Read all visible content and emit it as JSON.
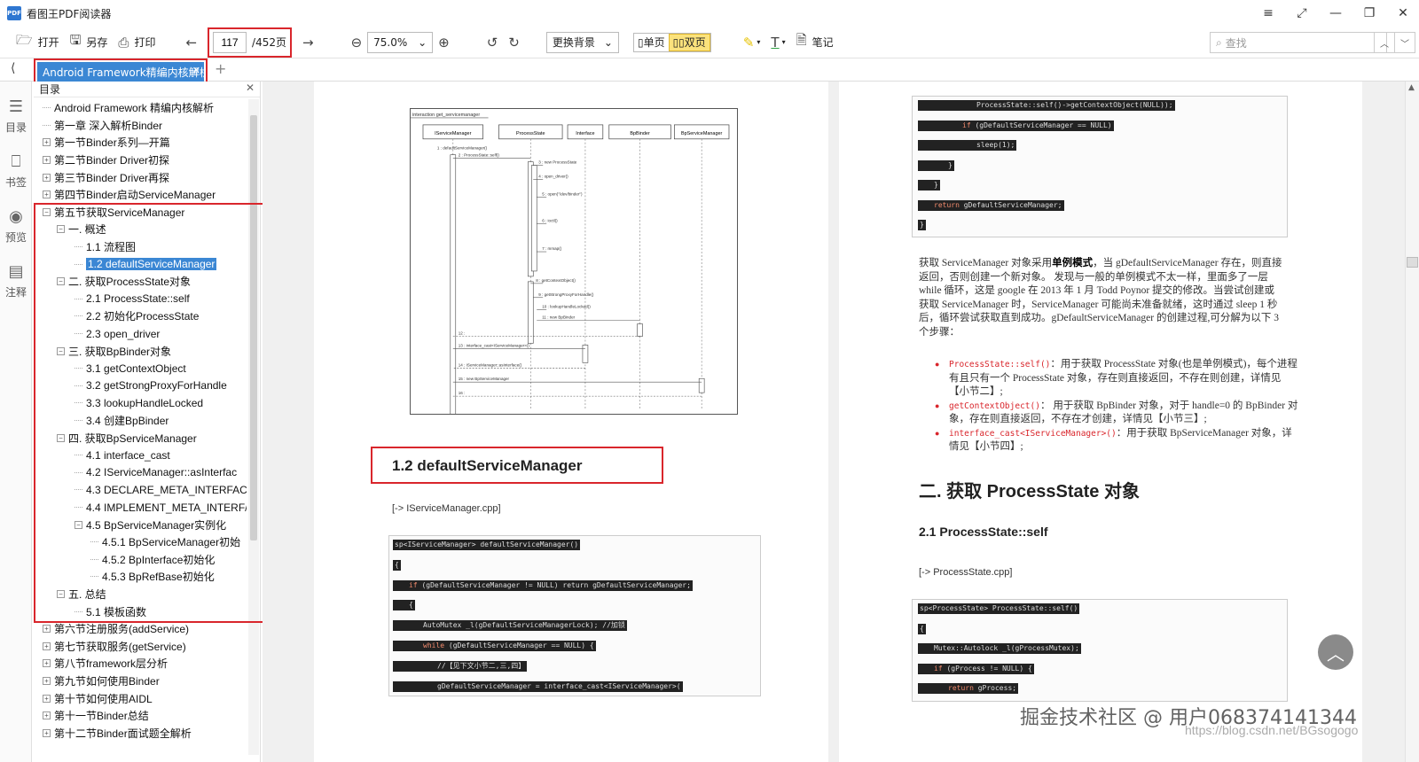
{
  "app": {
    "title": "看图王PDF阅读器",
    "logo_text": "PDF"
  },
  "window_controls": [
    "≡",
    "⤢",
    "—",
    "❐",
    "✕"
  ],
  "toolbar": {
    "open": "打开",
    "save": "另存",
    "print": "打印",
    "page_current": "117",
    "page_total": "/452页",
    "zoom": "75.0%",
    "background": "更换背景",
    "single": "单页",
    "double": "双页",
    "note": "笔记",
    "search_placeholder": "查找"
  },
  "tab": {
    "title": "Android Framework精编内核解析"
  },
  "rail": {
    "toc": "目录",
    "bookmark": "书签",
    "preview": "预览",
    "annot": "注释"
  },
  "outline": {
    "title": "目录",
    "items": [
      {
        "label": "Android Framework 精编内核解析",
        "level": 0,
        "exp": "none"
      },
      {
        "label": "第一章 深入解析Binder",
        "level": 0,
        "exp": "none"
      },
      {
        "label": "第一节Binder系列—开篇",
        "level": 0,
        "exp": "+"
      },
      {
        "label": "第二节Binder Driver初探",
        "level": 0,
        "exp": "+"
      },
      {
        "label": "第三节Binder Driver再探",
        "level": 0,
        "exp": "+"
      },
      {
        "label": "第四节Binder启动ServiceManager",
        "level": 0,
        "exp": "+"
      },
      {
        "label": "第五节获取ServiceManager",
        "level": 0,
        "exp": "-"
      },
      {
        "label": "一. 概述",
        "level": 1,
        "exp": "-"
      },
      {
        "label": "1.1 流程图",
        "level": 2,
        "exp": "none"
      },
      {
        "label": "1.2 defaultServiceManager",
        "level": 2,
        "exp": "none",
        "selected": true
      },
      {
        "label": "二. 获取ProcessState对象",
        "level": 1,
        "exp": "-"
      },
      {
        "label": "2.1 ProcessState::self",
        "level": 2,
        "exp": "none"
      },
      {
        "label": "2.2 初始化ProcessState",
        "level": 2,
        "exp": "none"
      },
      {
        "label": "2.3 open_driver",
        "level": 2,
        "exp": "none"
      },
      {
        "label": "三. 获取BpBinder对象",
        "level": 1,
        "exp": "-"
      },
      {
        "label": "3.1 getContextObject",
        "level": 2,
        "exp": "none"
      },
      {
        "label": "3.2 getStrongProxyForHandle",
        "level": 2,
        "exp": "none"
      },
      {
        "label": "3.3 lookupHandleLocked",
        "level": 2,
        "exp": "none"
      },
      {
        "label": "3.4 创建BpBinder",
        "level": 2,
        "exp": "none"
      },
      {
        "label": "四. 获取BpServiceManager",
        "level": 1,
        "exp": "-"
      },
      {
        "label": "4.1 interface_cast",
        "level": 2,
        "exp": "none"
      },
      {
        "label": "4.2 IServiceManager::asInterfac",
        "level": 2,
        "exp": "none"
      },
      {
        "label": "4.3 DECLARE_META_INTERFACE",
        "level": 2,
        "exp": "none"
      },
      {
        "label": "4.4 IMPLEMENT_META_INTERF/",
        "level": 2,
        "exp": "none"
      },
      {
        "label": "4.5 BpServiceManager实例化",
        "level": 2,
        "exp": "-"
      },
      {
        "label": "4.5.1 BpServiceManager初始",
        "level": 3,
        "exp": "none"
      },
      {
        "label": "4.5.2 BpInterface初始化",
        "level": 3,
        "exp": "none"
      },
      {
        "label": "4.5.3 BpRefBase初始化",
        "level": 3,
        "exp": "none"
      },
      {
        "label": "五. 总结",
        "level": 1,
        "exp": "-"
      },
      {
        "label": "5.1 模板函数",
        "level": 2,
        "exp": "none"
      },
      {
        "label": "第六节注册服务(addService)",
        "level": 0,
        "exp": "+"
      },
      {
        "label": "第七节获取服务(getService)",
        "level": 0,
        "exp": "+"
      },
      {
        "label": "第八节framework层分析",
        "level": 0,
        "exp": "+"
      },
      {
        "label": "第九节如何使用Binder",
        "level": 0,
        "exp": "+"
      },
      {
        "label": "第十节如何使用AIDL",
        "level": 0,
        "exp": "+"
      },
      {
        "label": "第十一节Binder总结",
        "level": 0,
        "exp": "+"
      },
      {
        "label": "第十二节Binder面试题全解析",
        "level": 0,
        "exp": "+"
      }
    ]
  },
  "diagram": {
    "title": "interaction get_servicemanager",
    "lifelines": [
      "IServiceManager",
      "ProcessState",
      "Interface",
      "BpBinder",
      "BpServiceManager"
    ],
    "messages": [
      "1 : defaultServiceManager()",
      "2 : ProcessState::self()",
      "3 : new ProcessState",
      "4 : open_driver()",
      "5 : open(\"/dev/binder\")",
      "6 : ioctl()",
      "7 : mmap()",
      "8 : getContextObject()",
      "9 : getStrongProxyForHandle()",
      "10 : lookupHandleLocked()",
      "11 : new BpBinder",
      "12 :",
      "13 : interface_cast<IServiceManager>()",
      "14 : IServiceManager::asInterface()",
      "15 : new BpServiceManager",
      "16 :"
    ]
  },
  "left_page": {
    "heading": "1.2 defaultServiceManager",
    "src": "[-> IServiceManager.cpp]",
    "code": [
      "sp<IServiceManager> defaultServiceManager()",
      "{",
      "    if (gDefaultServiceManager != NULL) return gDefaultServiceManager;",
      "    {",
      "        AutoMutex _l(gDefaultServiceManagerLock); //加锁",
      "        while (gDefaultServiceManager == NULL) {",
      "            //【见下文小节二,三,四】",
      "            gDefaultServiceManager = interface_cast<IServiceManager>("
    ]
  },
  "right_page": {
    "code_top": [
      "                ProcessState::self()->getContextObject(NULL));",
      "            if (gDefaultServiceManager == NULL)",
      "                sleep(1);",
      "        }",
      "    }",
      "    return gDefaultServiceManager;",
      "}"
    ],
    "para1_prefix": "获取 ServiceManager 对象采用",
    "para1_bold": "单例模式",
    "para1_rest": "，当 gDefaultServiceManager 存在，则直接返回，否则创建一个新对象。 发现与一般的单例模式不太一样，里面多了一层 while 循环，这是 google 在 2013 年 1 月 Todd Poynor 提交的修改。当尝试创建或获取 ServiceManager 时，ServiceManager 可能尚未准备就绪，这时通过 sleep 1 秒后，循环尝试获取直到成功。gDefaultServiceManager 的创建过程,可分解为以下 3 个步骤：",
    "bullets": [
      {
        "code": "ProcessState::self()",
        "text": "：用于获取 ProcessState 对象(也是单例模式)，每个进程有且只有一个 ProcessState 对象，存在则直接返回，不存在则创建，详情见【小节二】;"
      },
      {
        "code": "getContextObject()",
        "text": "： 用于获取 BpBinder 对象，对于 handle=0 的 BpBinder 对象，存在则直接返回，不存在才创建，详情见【小节三】;"
      },
      {
        "code": "interface_cast<IServiceManager>()",
        "text": "：用于获取 BpServiceManager 对象，详情见【小节四】;"
      }
    ],
    "h2": "二. 获取 ProcessState 对象",
    "h3": "2.1 ProcessState::self",
    "src": "[-> ProcessState.cpp]",
    "code_bottom": [
      "sp<ProcessState> ProcessState::self()",
      "{",
      "    Mutex::Autolock _l(gProcessMutex);",
      "    if (gProcess != NULL) {",
      "        return gProcess;"
    ]
  },
  "overlay": {
    "watermark": "掘金技术社区 @ 用户068374141344",
    "watermark2": "https://blog.csdn.net/BGsogogo",
    "back_top": "︿"
  }
}
